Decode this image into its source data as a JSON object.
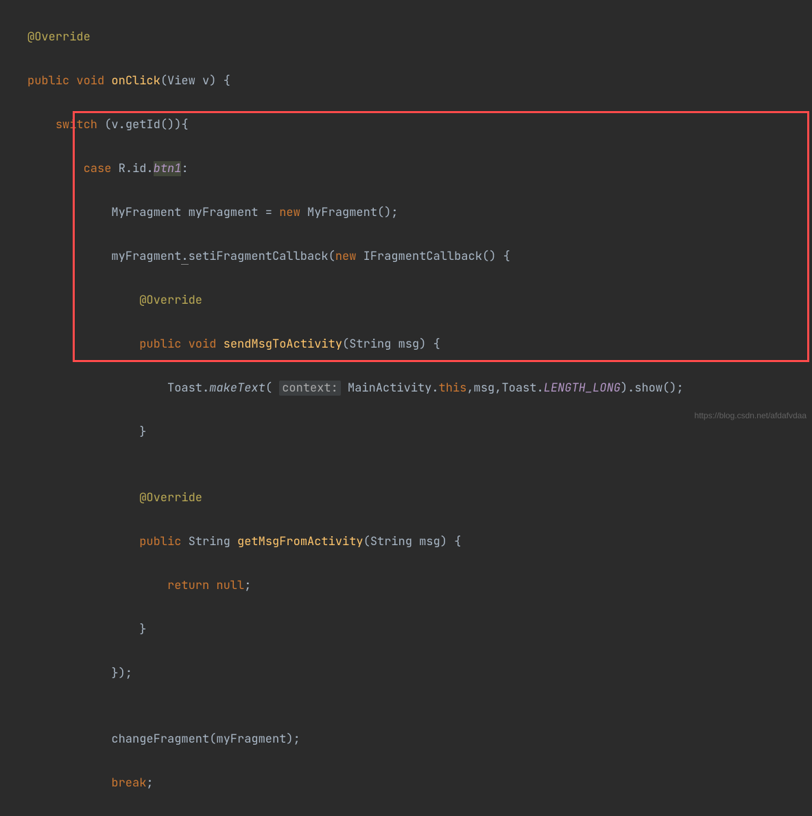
{
  "code": {
    "l1": {
      "ann": "@Override"
    },
    "l2": {
      "kw1": "public",
      "kw2": "void",
      "m": "onClick",
      "tail": "(View v) {"
    },
    "l3": {
      "kw": "switch",
      "tail": " (v.getId()){"
    },
    "l4": {
      "kw": "case",
      "pre": " R.id.",
      "f": "btn1",
      "col": ":"
    },
    "l5": {
      "a": "MyFragment myFragment = ",
      "kw": "new",
      "b": " MyFragment();"
    },
    "l6": {
      "a": "myFragment",
      "dot": ".",
      "b": "setiFragmentCallback(",
      "kw": "new",
      "c": " IFragmentCallback() {"
    },
    "l7": {
      "ann": "@Override"
    },
    "l8": {
      "kw1": "public",
      "kw2": "void",
      "m": "sendMsgToActivity",
      "tail": "(String msg) {"
    },
    "l9": {
      "a": "Toast.",
      "sm": "makeText",
      "op": "( ",
      "hint": "context:",
      "b": " MainActivity.",
      "kw": "this",
      "c": ",msg,Toast.",
      "f": "LENGTH_LONG",
      "d": ").show();"
    },
    "l10": {
      "brace": "}"
    },
    "l11": {
      "blank": ""
    },
    "l12": {
      "ann": "@Override"
    },
    "l13": {
      "kw1": "public",
      "t": " String ",
      "m": "getMsgFromActivity",
      "tail": "(String msg) {"
    },
    "l14": {
      "kw": "return null",
      "semi": ";"
    },
    "l15": {
      "brace": "}"
    },
    "l16": {
      "end": "});"
    },
    "l17": {
      "blank": ""
    },
    "l18": {
      "a": "changeFragment(myFragment);"
    },
    "l19": {
      "kw": "break",
      "semi": ";"
    }
  },
  "watermark": "https://blog.csdn.net/afdafvdaa"
}
